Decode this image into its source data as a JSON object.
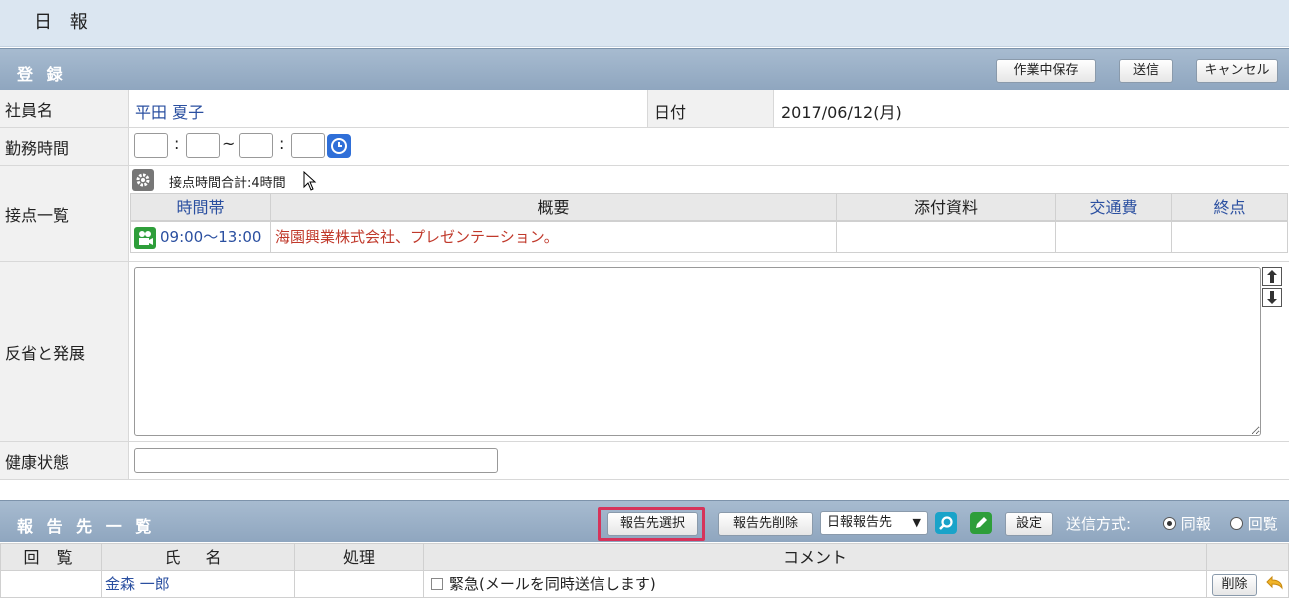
{
  "header": {
    "title": "日 報"
  },
  "registration": {
    "section_title": "登 録",
    "buttons": {
      "save_draft": "作業中保存",
      "send": "送信",
      "cancel": "キャンセル"
    },
    "employee_label": "社員名",
    "employee_name": "平田 夏子",
    "date_label": "日付",
    "date_value": "2017/06/12(月)",
    "worktime_label": "勤務時間",
    "worktime_colon1": ":",
    "worktime_tilde": "~",
    "worktime_colon2": ":",
    "contacts_label": "接点一覧",
    "contacts_total": "接点時間合計:4時間",
    "contacts_columns": [
      "時間帯",
      "概要",
      "添付資料",
      "交通費",
      "終点"
    ],
    "contacts_rows": [
      {
        "time": "09:00～13:00",
        "summary": "海園興業株式会社、プレゼンテーション。",
        "attachments": "",
        "fare": "",
        "end": ""
      }
    ],
    "reflection_label": "反省と発展",
    "health_label": "健康状態"
  },
  "report_targets": {
    "section_title": "報 告 先 一 覧",
    "buttons": {
      "select": "報告先選択",
      "delete_target": "報告先削除",
      "settings": "設定"
    },
    "dropdown_value": "日報報告先",
    "send_method_label": "送信方式:",
    "send_options": [
      {
        "label": "同報",
        "selected": true
      },
      {
        "label": "回覧",
        "selected": false
      }
    ],
    "columns": [
      "回 覧",
      "氏 名",
      "処理",
      "コメント"
    ],
    "rows": [
      {
        "circulate": "",
        "name": "金森 一郎",
        "process": "",
        "urgent_label": "緊急(メールを同時送信します)",
        "delete_label": "削除"
      }
    ]
  },
  "colors": {
    "highlight": "#d6335a",
    "link": "#2a4fa0",
    "summary": "#c0392b",
    "header": "#9bb0c7"
  }
}
